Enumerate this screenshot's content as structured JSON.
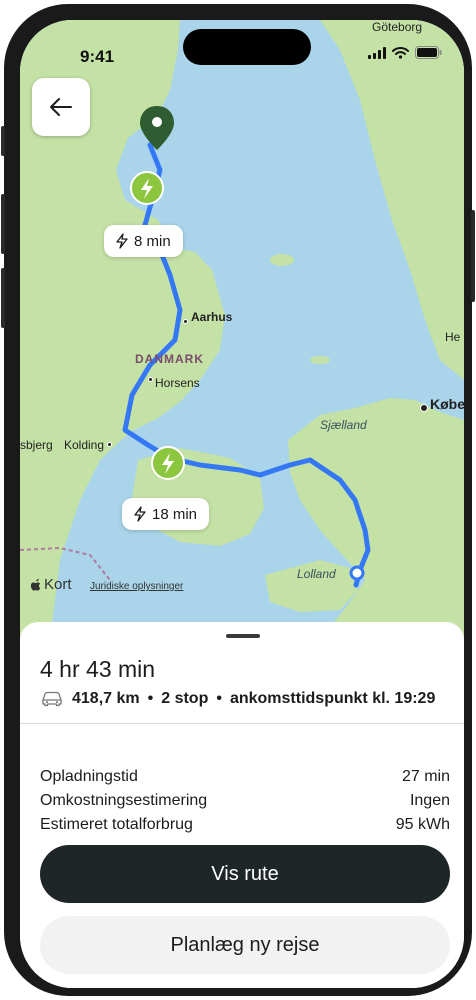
{
  "status_bar": {
    "time": "9:41"
  },
  "map": {
    "labels": {
      "goteborg": "Göteborg",
      "aarhus": "Aarhus",
      "danmark": "DANMARK",
      "horsens": "Horsens",
      "kolding": "Kolding",
      "esbjerg": "sbjerg",
      "sjaelland": "Sjælland",
      "lolland": "Lolland",
      "kobenhavn": "Købe",
      "he": "He"
    },
    "charge_stop_1": {
      "time": "8 min"
    },
    "charge_stop_2": {
      "time": "18 min"
    },
    "attribution": {
      "brand": "Kort",
      "legal": "Juridiske oplysninger"
    },
    "colors": {
      "route": "#3478f6",
      "charger": "#8cc63f",
      "pin": "#2f5d31",
      "water": "#a9d4ea",
      "land": "#c5e2a6"
    }
  },
  "trip": {
    "duration": "4 hr 43 min",
    "distance": "418,7 km",
    "stops": "2 stop",
    "arrival": "ankomsttidspunkt kl. 19:29",
    "separator": "•",
    "details": [
      {
        "label": "Opladningstid",
        "value": "27 min"
      },
      {
        "label": "Omkostningsestimering",
        "value": "Ingen"
      },
      {
        "label": "Estimeret totalforbrug",
        "value": "95 kWh"
      }
    ]
  },
  "actions": {
    "primary": "Vis rute",
    "secondary": "Planlæg ny rejse"
  }
}
